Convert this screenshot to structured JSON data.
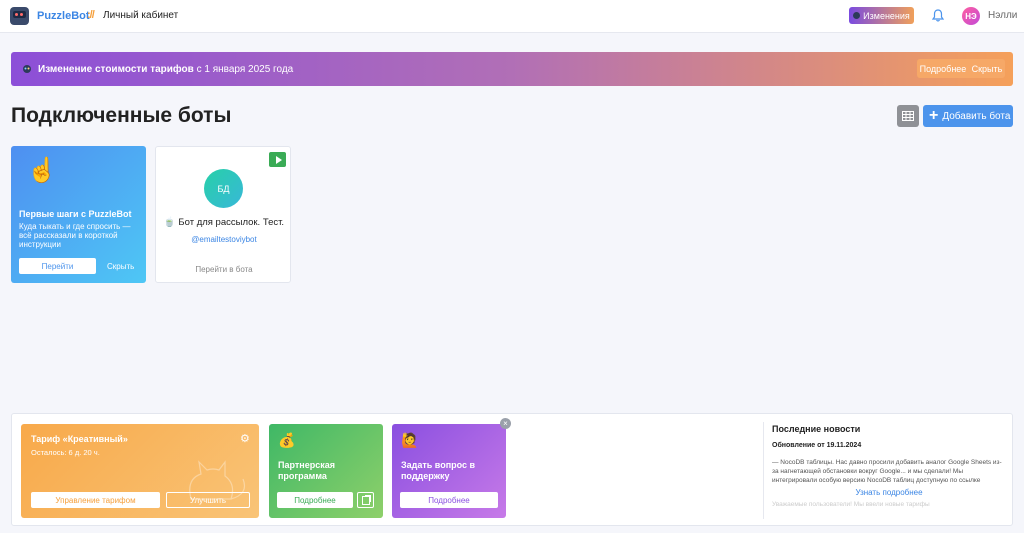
{
  "header": {
    "brand": "PuzzleBot",
    "separator": "://",
    "section": "Личный кабинет",
    "changes_label": "Изменения",
    "avatar_initials": "НЭ",
    "username": "Нэлли"
  },
  "banner": {
    "title_bold": "Изменение стоимости тарифов",
    "title_rest": " с 1 января 2025 года",
    "more_label": "Подробнее",
    "hide_label": "Скрыть"
  },
  "main": {
    "title": "Подключенные боты",
    "add_bot_label": "Добавить бота"
  },
  "start_card": {
    "title": "Первые шаги с PuzzleBot",
    "description": "Куда тыкать и где спросить — всё рассказали в короткой инструкции",
    "go_label": "Перейти",
    "hide_label": "Скрыть"
  },
  "bot_card": {
    "avatar_initials": "БД",
    "name": "Бот для рассылок. Тест.",
    "username": "@emailtestoviybot",
    "link_label": "Перейти в бота"
  },
  "tariff": {
    "title": "Тариф «Креативный»",
    "remaining": "Осталось: 6 д. 20 ч.",
    "manage_label": "Управление тарифом",
    "upgrade_label": "Улучшить"
  },
  "partner": {
    "title": "Партнерская программа",
    "more_label": "Подробнее"
  },
  "support": {
    "title": "Задать вопрос в поддержку",
    "more_label": "Подробнее"
  },
  "news": {
    "title": "Последние новости",
    "date": "Обновление от 19.11.2024",
    "text": "— NocoDB таблицы. Нас давно просили добавить аналог Google Sheets из-за нагнетающей обстановки вокруг Google... и мы сделали! Мы интегрировали особую версию NocoDB таблиц доступную по ссылке",
    "more_label": "Узнать подробнее",
    "fade_text": "Уважаемые пользователи! Мы ввели новые тарифы"
  },
  "colors": {
    "accent": "#4c94ec",
    "banner_start": "#8c4fd8",
    "banner_end": "#f5a05a",
    "success": "#3aab55"
  }
}
